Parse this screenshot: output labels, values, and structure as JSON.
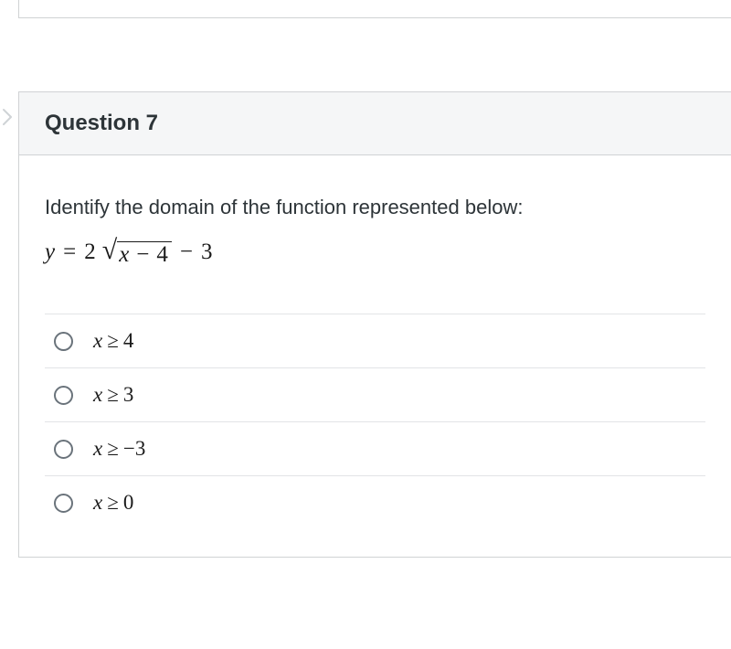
{
  "question": {
    "title": "Question 7",
    "prompt": "Identify the domain of the function represented below:",
    "equation": {
      "lhs_var": "y",
      "eq_sign": "=",
      "coeff": "2",
      "radicand_var": "x",
      "radicand_op": "−",
      "radicand_const": "4",
      "after_op": "−",
      "after_const": "3"
    },
    "options": [
      {
        "var": "x",
        "rel": "≥",
        "val": "4"
      },
      {
        "var": "x",
        "rel": "≥",
        "val": "3"
      },
      {
        "var": "x",
        "rel": "≥",
        "val": "−3"
      },
      {
        "var": "x",
        "rel": "≥",
        "val": "0"
      }
    ]
  }
}
